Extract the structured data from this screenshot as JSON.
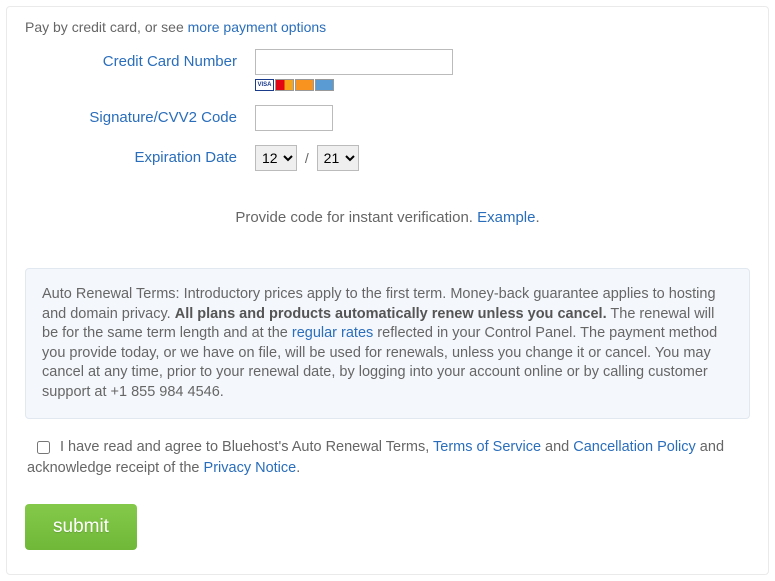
{
  "intro": {
    "prefix": "Pay by credit card, or see ",
    "link": "more payment options"
  },
  "fields": {
    "cc_label": "Credit Card Number",
    "cvv_label": "Signature/CVV2 Code",
    "exp_label": "Expiration Date",
    "month_value": "12",
    "year_value": "21",
    "slash": "/"
  },
  "verify": {
    "text": "Provide code for instant verification. ",
    "link": "Example",
    "dot": "."
  },
  "terms": {
    "pre": "Auto Renewal Terms: Introductory prices apply to the first term. Money-back guarantee applies to hosting and domain privacy. ",
    "bold": "All plans and products automatically renew unless you cancel.",
    "mid": " The renewal will be for the same term length and at the ",
    "regular_link": "regular rates",
    "post": " reflected in your Control Panel. The payment method you provide today, or we have on file, will be used for renewals, unless you change it or cancel. You may cancel at any time, prior to your renewal date, by logging into your account online or by calling customer support at +1 855 984 4546."
  },
  "agree": {
    "t1": "I have read and agree to Bluehost's Auto Renewal Terms, ",
    "tos": "Terms of Service",
    "t2": " and ",
    "cancel": "Cancellation Policy",
    "t3": " and acknowledge receipt of the ",
    "privacy": "Privacy Notice",
    "t4": "."
  },
  "submit_label": "submit"
}
